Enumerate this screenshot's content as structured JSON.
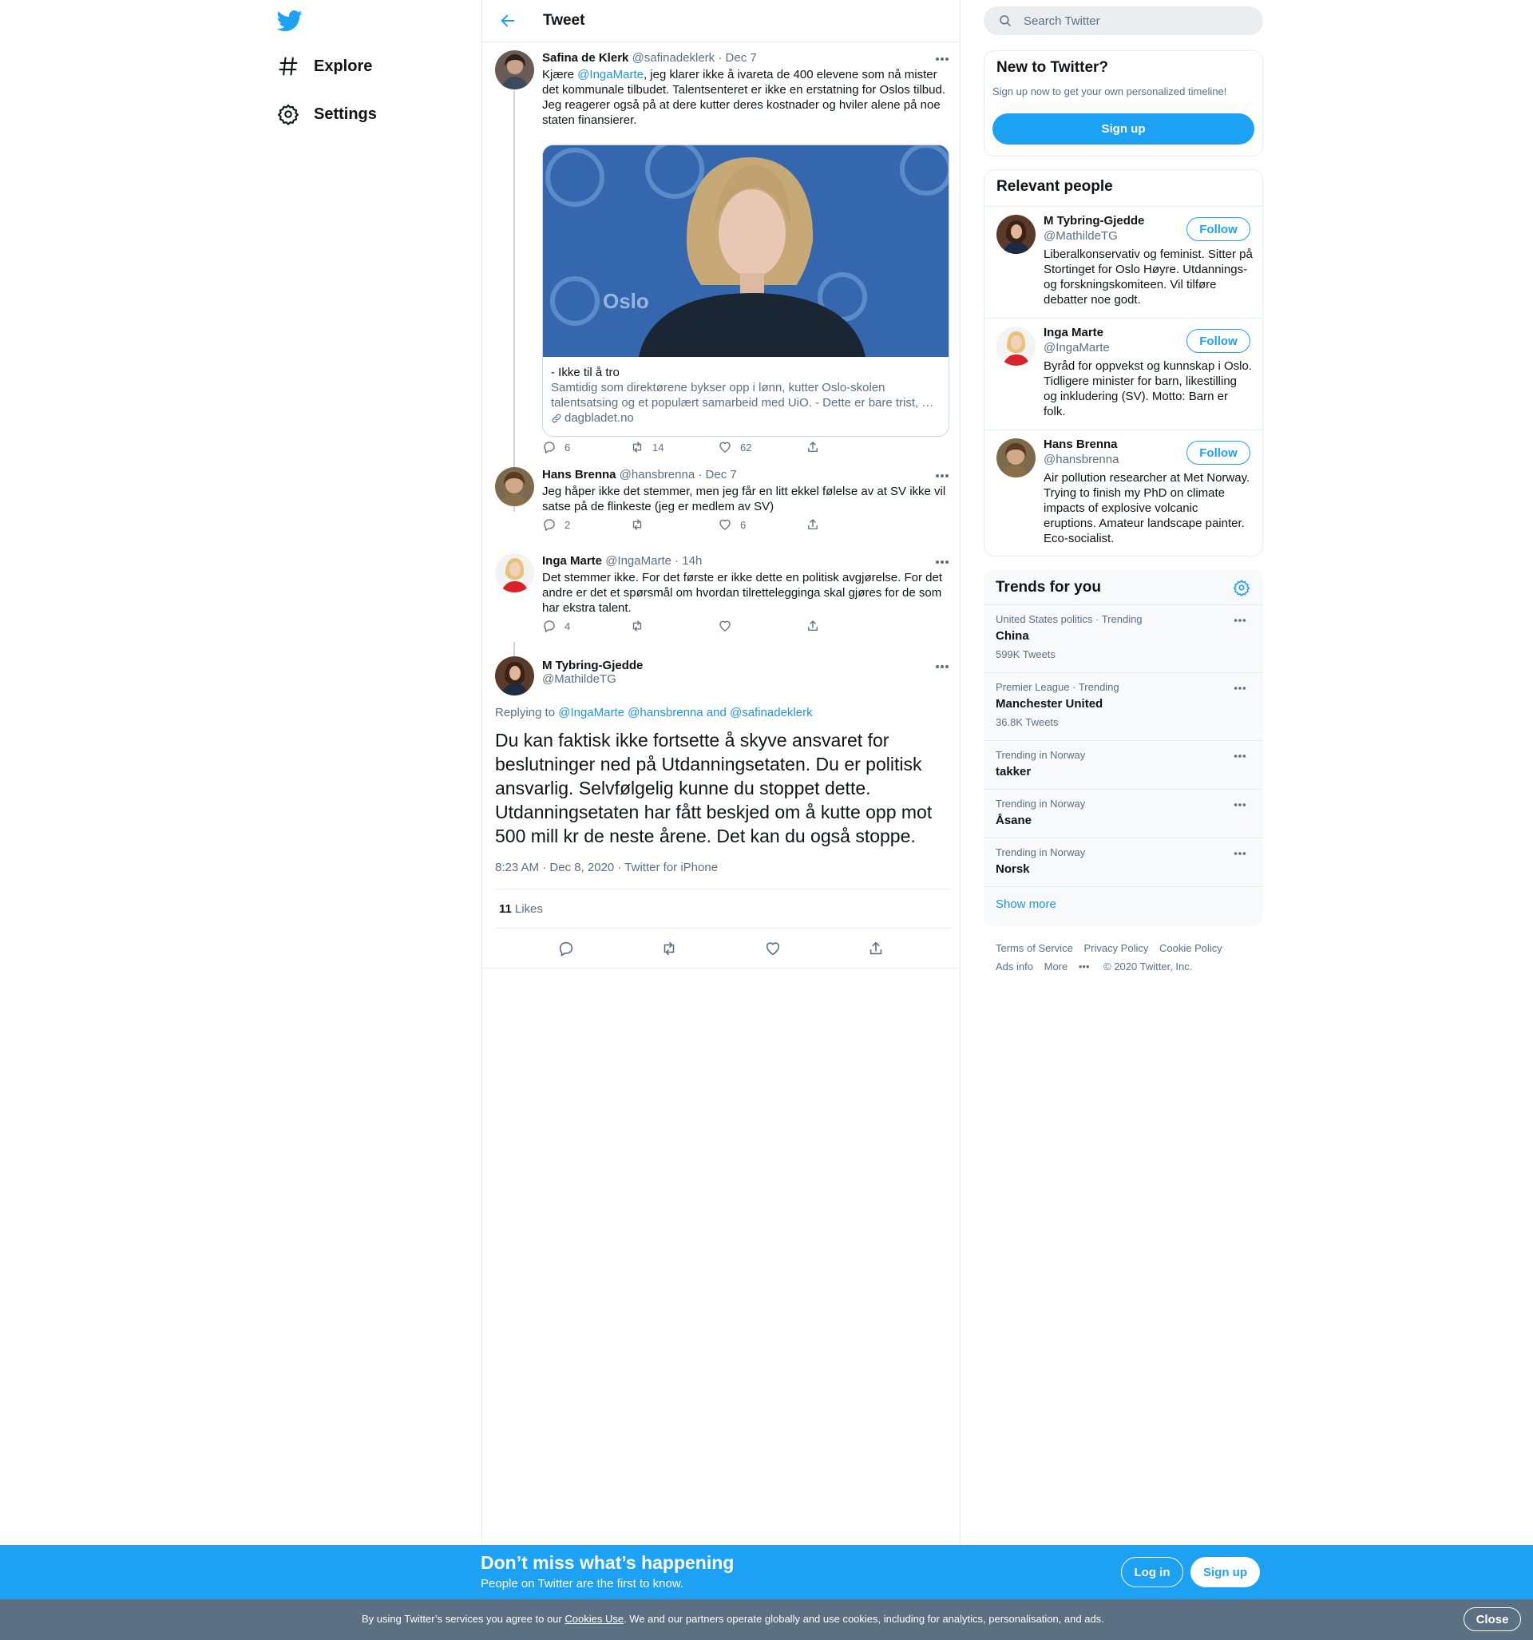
{
  "colors": {
    "accent": "#1da1f2",
    "link": "#1b95e0",
    "muted": "#5b7083",
    "border": "#e6ecf0"
  },
  "nav": {
    "items": [
      {
        "label": "Explore",
        "icon": "hashtag-icon"
      },
      {
        "label": "Settings",
        "icon": "gear-icon"
      }
    ]
  },
  "header": {
    "title": "Tweet"
  },
  "thread": [
    {
      "name": "Safina de Klerk",
      "handle": "@safinadeklerk",
      "time": "Dec 7",
      "text_prefix": "Kjære ",
      "mention": "@IngaMarte",
      "text_rest": ", jeg klarer ikke å ivareta de 400 elevene som nå mister det kommunale tilbudet. Talentsenteret er ikke en erstatning for Oslos tilbud. Jeg reagerer også på at dere kutter deres kostnader og hviler alene på noe staten finansierer.",
      "card": {
        "image_text": "Oslo",
        "title": "- Ikke til å tro",
        "description": "Samtidig som direktørene bykser opp i lønn, kutter Oslo-skolen talentsatsing og et populært samarbeid med UiO. - Dette er bare trist, …",
        "domain": "dagbladet.no"
      },
      "replies": "6",
      "retweets": "14",
      "likes": "62"
    },
    {
      "name": "Hans Brenna",
      "handle": "@hansbrenna",
      "time": "Dec 7",
      "text": "Jeg håper ikke det stemmer, men jeg får en litt ekkel følelse av at SV ikke vil satse på de flinkeste (jeg er medlem av SV)",
      "replies": "2",
      "retweets": "",
      "likes": "6"
    },
    {
      "name": "Inga Marte",
      "handle": "@IngaMarte",
      "time": "14h",
      "text": "Det stemmer ikke. For det første er ikke dette en politisk avgjørelse. For det andre er det et spørsmål om hvordan tilretteleggingа skal gjøres for de som har ekstra talent.",
      "replies": "4",
      "retweets": "",
      "likes": ""
    }
  ],
  "main_tweet": {
    "name": "M Tybring-Gjedde",
    "handle": "@MathildeTG",
    "replying_label": "Replying to ",
    "replying_to": "@IngaMarte @hansbrenna and @safinadeklerk",
    "text": "Du kan faktisk ikke fortsette å skyve ansvaret for beslutninger ned på Utdanningsetaten. Du er politisk ansvarlig. Selvfølgelig kunne du stoppet dette. Utdanningsetaten har fått beskjed om å kutte opp mot 500 mill kr de neste årene. Det kan du også stoppe.",
    "timestamp": "8:23 AM · Dec 8, 2020 · Twitter for iPhone",
    "likes_count": "11",
    "likes_label": "Likes"
  },
  "search": {
    "placeholder": "Search Twitter"
  },
  "new_to_twitter": {
    "title": "New to Twitter?",
    "subtitle": "Sign up now to get your own personalized timeline!",
    "button": "Sign up"
  },
  "relevant_people": {
    "title": "Relevant people",
    "follow_label": "Follow",
    "people": [
      {
        "name": "M Tybring-Gjedde",
        "handle": "@MathildeTG",
        "bio": "Liberalkonservativ og feminist. Sitter på Stortinget for Oslo Høyre. Utdannings- og forskningskomiteen. Vil tilføre debatter noe godt."
      },
      {
        "name": "Inga Marte",
        "handle": "@IngaMarte",
        "bio": "Byråd for oppvekst og kunnskap i Oslo. Tidligere minister for barn, likestilling og inkludering (SV). Motto: Barn er folk."
      },
      {
        "name": "Hans Brenna",
        "handle": "@hansbrenna",
        "bio": "Air pollution researcher at Met Norway. Trying to finish my PhD on climate impacts of explosive volcanic eruptions. Amateur landscape painter. Eco-socialist."
      }
    ]
  },
  "trends": {
    "title": "Trends for you",
    "items": [
      {
        "context": "United States politics · Trending",
        "name": "China",
        "count": "599K Tweets"
      },
      {
        "context": "Premier League · Trending",
        "name": "Manchester United",
        "count": "36.8K Tweets"
      },
      {
        "context": "Trending in Norway",
        "name": "takker",
        "count": ""
      },
      {
        "context": "Trending in Norway",
        "name": "Åsane",
        "count": ""
      },
      {
        "context": "Trending in Norway",
        "name": "Norsk",
        "count": ""
      }
    ],
    "show_more": "Show more"
  },
  "footer": {
    "links": [
      "Terms of Service",
      "Privacy Policy",
      "Cookie Policy",
      "Ads info",
      "More"
    ],
    "copyright": "© 2020 Twitter, Inc."
  },
  "promo": {
    "title": "Don’t miss what’s happening",
    "subtitle": "People on Twitter are the first to know.",
    "login": "Log in",
    "signup": "Sign up"
  },
  "cookie": {
    "text_before": "By using Twitter’s services you agree to our ",
    "link": "Cookies Use",
    "text_after": ". We and our partners operate globally and use cookies, including for analytics, personalisation, and ads.",
    "close": "Close"
  }
}
